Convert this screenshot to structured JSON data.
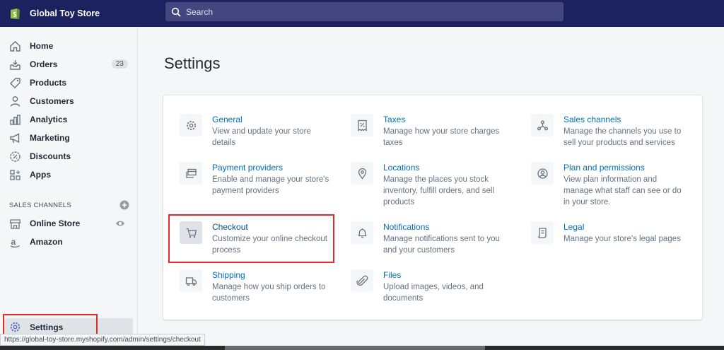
{
  "topbar": {
    "store_name": "Global Toy Store",
    "search_placeholder": "Search"
  },
  "sidebar": {
    "items": [
      {
        "label": "Home",
        "icon": "home-icon"
      },
      {
        "label": "Orders",
        "icon": "orders-icon",
        "badge": "23"
      },
      {
        "label": "Products",
        "icon": "tag-icon"
      },
      {
        "label": "Customers",
        "icon": "person-icon"
      },
      {
        "label": "Analytics",
        "icon": "bar-chart-icon"
      },
      {
        "label": "Marketing",
        "icon": "megaphone-icon"
      },
      {
        "label": "Discounts",
        "icon": "discount-icon"
      },
      {
        "label": "Apps",
        "icon": "apps-icon"
      }
    ],
    "sales_channels_label": "SALES CHANNELS",
    "channels": [
      {
        "label": "Online Store",
        "icon": "store-icon"
      },
      {
        "label": "Amazon",
        "icon": "amazon-icon"
      }
    ],
    "settings_label": "Settings"
  },
  "main": {
    "title": "Settings",
    "tiles": [
      {
        "title": "General",
        "desc_lines": [
          "View and update your store",
          "details"
        ],
        "icon": "gear-icon"
      },
      {
        "title": "Taxes",
        "desc_lines": [
          "Manage how your store charges",
          "taxes"
        ],
        "icon": "receipt-icon"
      },
      {
        "title": "Sales channels",
        "desc_lines": [
          "Manage the channels you use to",
          "sell your products and services"
        ],
        "icon": "network-icon"
      },
      {
        "title": "Payment providers",
        "desc_lines": [
          "Enable and manage your store's",
          "payment providers"
        ],
        "icon": "payment-icon"
      },
      {
        "title": "Locations",
        "desc_lines": [
          "Manage the places you stock",
          "inventory, fulfill orders, and sell",
          "products"
        ],
        "icon": "location-pin-icon"
      },
      {
        "title": "Plan and permissions",
        "desc_lines": [
          "View plan information and",
          "manage what staff can see or do",
          "in your store."
        ],
        "icon": "account-icon"
      },
      {
        "title": "Checkout",
        "desc_lines": [
          "Customize your online checkout",
          "process"
        ],
        "icon": "cart-icon"
      },
      {
        "title": "Notifications",
        "desc_lines": [
          "Manage notifications sent to you",
          "and your customers"
        ],
        "icon": "bell-icon"
      },
      {
        "title": "Legal",
        "desc_lines": [
          "Manage your store's legal pages"
        ],
        "icon": "document-icon"
      },
      {
        "title": "Shipping",
        "desc_lines": [
          "Manage how you ship orders to",
          "customers"
        ],
        "icon": "truck-icon"
      },
      {
        "title": "Files",
        "desc_lines": [
          "Upload images, videos, and",
          "documents"
        ],
        "icon": "paperclip-icon"
      }
    ]
  },
  "statusbar": {
    "url": "https://global-toy-store.myshopify.com/admin/settings/checkout"
  },
  "colors": {
    "topbar": "#1c2260",
    "link": "#006fbb",
    "highlight_border": "#e32929"
  }
}
